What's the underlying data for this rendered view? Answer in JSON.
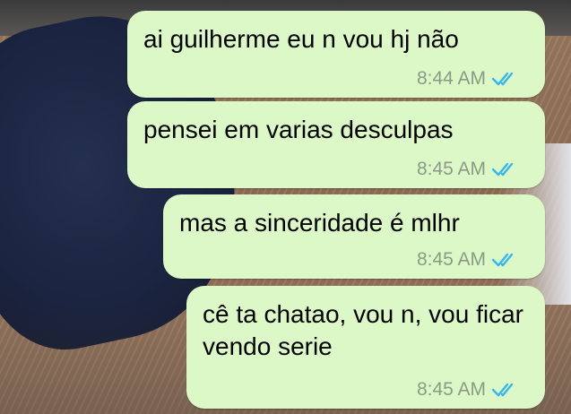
{
  "messages": [
    {
      "text": "ai guilherme eu n vou hj não",
      "time": "8:44 AM",
      "status_icon": "double-check-read-icon"
    },
    {
      "text": "pensei em varias desculpas",
      "time": "8:45 AM",
      "status_icon": "double-check-read-icon"
    },
    {
      "text": "mas a sinceridade é mlhr",
      "time": "8:45 AM",
      "status_icon": "double-check-read-icon"
    },
    {
      "text": "cê ta chatao, vou n, vou ficar vendo serie",
      "time": "8:45 AM",
      "status_icon": "double-check-read-icon"
    }
  ],
  "colors": {
    "bubble_outgoing": "#dcf8c6",
    "read_check": "#34b7f1",
    "timestamp": "#8b9a86"
  }
}
